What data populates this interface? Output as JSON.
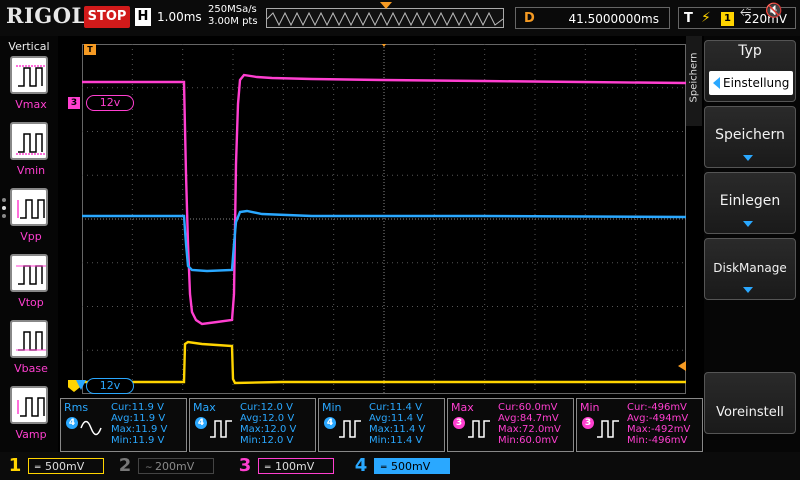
{
  "header": {
    "logo": "RIGOL",
    "run_state": "STOP",
    "timebase_badge": "H",
    "timebase": "1.00ms",
    "sample_rate": "250MSa/s",
    "memory_depth": "3.00M pts",
    "delay_label": "D",
    "delay_value": "41.5000000ms",
    "trigger_label": "T",
    "trigger_channel": "1",
    "trigger_level": "220mV"
  },
  "left_panel": {
    "title": "Vertical",
    "items": [
      {
        "label": "Vmax"
      },
      {
        "label": "Vmin"
      },
      {
        "label": "Vpp"
      },
      {
        "label": "Vtop"
      },
      {
        "label": "Vbase"
      },
      {
        "label": "Vamp"
      }
    ]
  },
  "screen": {
    "ch3_offset_label": "12v",
    "ch1_offset_label": "12v",
    "ch3_marker": "3",
    "trigger_marker": "T"
  },
  "right_panel": {
    "menu_title": "Speichern",
    "softkeys": [
      {
        "title": "Typ",
        "selection": "Einstellung"
      },
      {
        "label": "Speichern"
      },
      {
        "label": "Einlegen"
      },
      {
        "label": "DiskManage"
      },
      {
        "label": "Voreinstell"
      }
    ]
  },
  "measurements": [
    {
      "name": "Rms",
      "channel": "4",
      "color": "#2aa8ff",
      "cur": "Cur:11.9 V",
      "avg": "Avg:11.9 V",
      "max": "Max:11.9 V",
      "min": "Min:11.9 V"
    },
    {
      "name": "Max",
      "channel": "4",
      "color": "#2aa8ff",
      "cur": "Cur:12.0 V",
      "avg": "Avg:12.0 V",
      "max": "Max:12.0 V",
      "min": "Min:12.0 V"
    },
    {
      "name": "Min",
      "channel": "4",
      "color": "#2aa8ff",
      "cur": "Cur:11.4 V",
      "avg": "Avg:11.4 V",
      "max": "Max:11.4 V",
      "min": "Min:11.4 V"
    },
    {
      "name": "Max",
      "channel": "3",
      "color": "#ff3fd0",
      "cur": "Cur:60.0mV",
      "avg": "Avg:84.7mV",
      "max": "Max:72.0mV",
      "min": "Min:60.0mV"
    },
    {
      "name": "Min",
      "channel": "3",
      "color": "#ff3fd0",
      "cur": "Cur:-496mV",
      "avg": "Avg:-494mV",
      "max": "Max:-492mV",
      "min": "Min:-496mV"
    }
  ],
  "channels": [
    {
      "num": "1",
      "scale": "500mV",
      "color": "#ffd400",
      "active": true
    },
    {
      "num": "2",
      "scale": "200mV",
      "color": "#3ac3b0",
      "active": false
    },
    {
      "num": "3",
      "scale": "100mV",
      "color": "#ff3fd0",
      "active": true
    },
    {
      "num": "4",
      "scale": "500mV",
      "color": "#2aa8ff",
      "active": true
    }
  ],
  "icons": {
    "usb": "usb-icon",
    "speaker": "speaker-muted-icon"
  }
}
